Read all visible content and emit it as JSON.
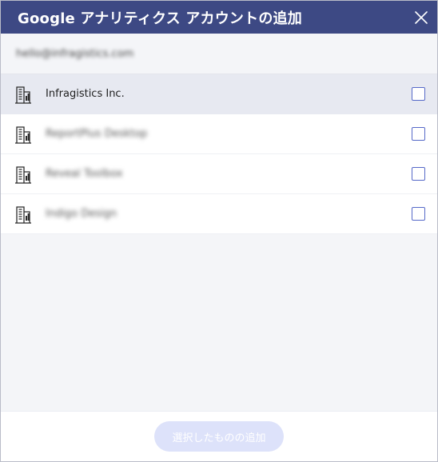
{
  "dialog": {
    "title": "Google アナリティクス アカウントの追加",
    "account_email": "hello@infragistics.com"
  },
  "list": {
    "items": [
      {
        "label": "Infragistics Inc.",
        "blurred": false,
        "checked": false,
        "icon": "building-icon"
      },
      {
        "label": "ReportPlus Desktop",
        "blurred": true,
        "checked": false,
        "icon": "building-icon"
      },
      {
        "label": "Reveal Toolbox",
        "blurred": true,
        "checked": false,
        "icon": "building-icon"
      },
      {
        "label": "Indigo Design",
        "blurred": true,
        "checked": false,
        "icon": "building-icon"
      }
    ]
  },
  "footer": {
    "add_label": "選択したものの追加"
  },
  "colors": {
    "titlebar": "#3d4984",
    "accent": "#5669c8",
    "selected_row": "#e7e9f1",
    "disabled_button": "#dde2fa"
  }
}
